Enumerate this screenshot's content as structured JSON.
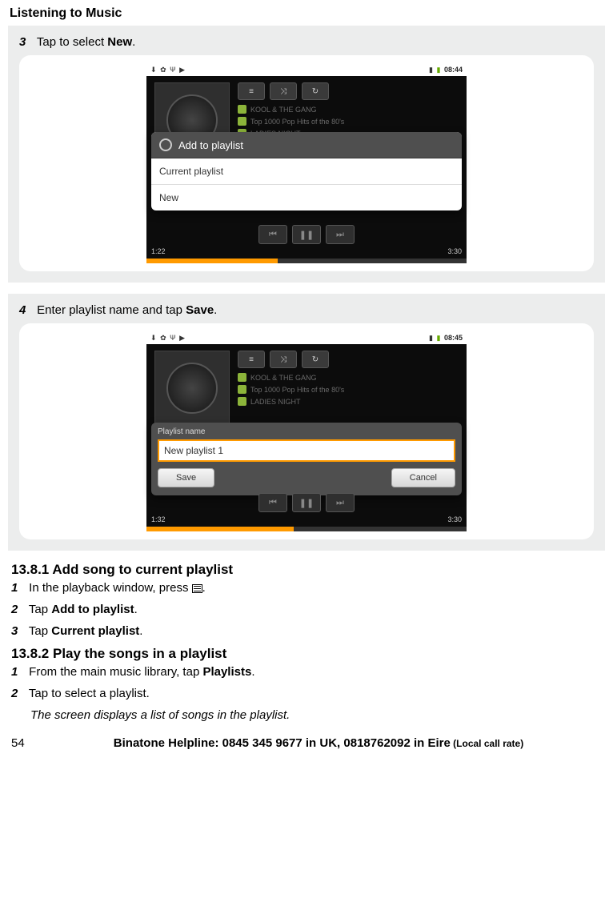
{
  "page_title": "Listening to Music",
  "step3": {
    "num": "3",
    "pre": "Tap to select ",
    "bold": "New",
    "post": "."
  },
  "shot1": {
    "time": "08:44",
    "artist": "KOOL & THE GANG",
    "track": "Top 1000 Pop Hits of the 80's",
    "song": "LADIES NIGHT",
    "dialog_title": "Add to playlist",
    "opt1": "Current playlist",
    "opt2": "New",
    "elapsed": "1:22",
    "total": "3:30",
    "progress_pct": 41
  },
  "step4": {
    "num": "4",
    "pre": "Enter playlist name and tap ",
    "bold": "Save",
    "post": "."
  },
  "shot2": {
    "time": "08:45",
    "artist": "KOOL & THE GANG",
    "track": "Top 1000 Pop Hits of the 80's",
    "song": "LADIES NIGHT",
    "input_label": "Playlist name",
    "input_value": "New playlist 1",
    "btn_save": "Save",
    "btn_cancel": "Cancel",
    "elapsed": "1:32",
    "total": "3:30",
    "progress_pct": 46
  },
  "sec1": {
    "heading": "13.8.1 Add song to current playlist",
    "s1": {
      "num": "1",
      "pre": "In the playback window, press ",
      "post": "."
    },
    "s2": {
      "num": "2",
      "pre": "Tap ",
      "bold": "Add to playlist",
      "post": "."
    },
    "s3": {
      "num": "3",
      "pre": "Tap ",
      "bold": "Current playlist",
      "post": "."
    }
  },
  "sec2": {
    "heading": "13.8.2 Play the songs in a playlist",
    "s1": {
      "num": "1",
      "pre": "From the main music library, tap ",
      "bold": "Playlists",
      "post": "."
    },
    "s2": {
      "num": "2",
      "text": "Tap to select a playlist."
    },
    "note": "The screen displays a list of songs in the playlist."
  },
  "footer": {
    "page": "54",
    "main": "Binatone Helpline: 0845 345 9677 in UK, 0818762092 in Eire",
    "note": " (Local call rate)"
  }
}
